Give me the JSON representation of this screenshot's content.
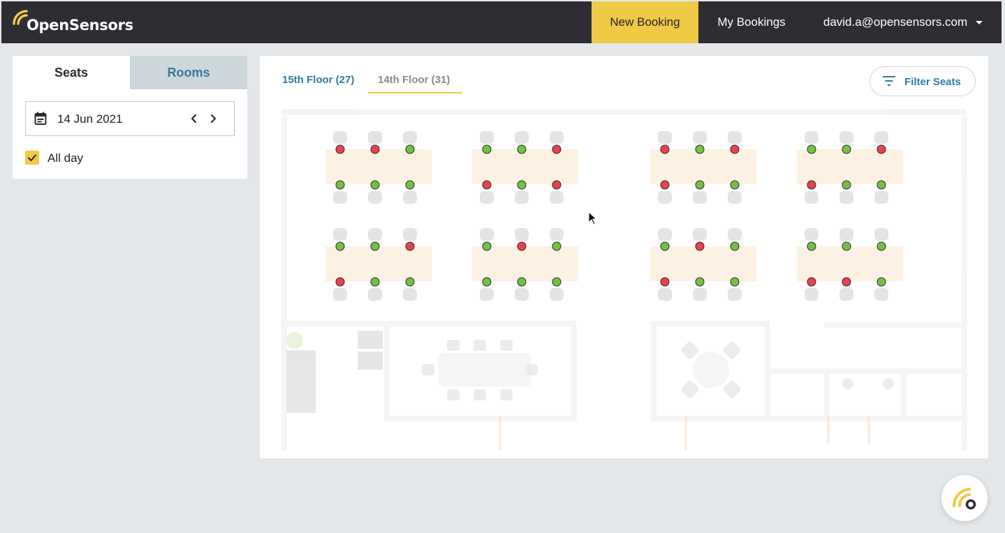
{
  "header": {
    "logo_text": "OpenSensors",
    "nav": {
      "new_booking": "New Booking",
      "my_bookings": "My Bookings",
      "user_email": "david.a@opensensors.com"
    }
  },
  "sidebar": {
    "tabs": {
      "seats": "Seats",
      "rooms": "Rooms"
    },
    "active_tab": "Seats",
    "date": "14 Jun 2021",
    "all_day": {
      "label": "All day",
      "checked": true
    }
  },
  "main": {
    "floor_tabs": [
      {
        "label": "15th Floor (27)",
        "active": false
      },
      {
        "label": "14th Floor (31)",
        "active": true
      }
    ],
    "filter_label": "Filter Seats",
    "legend_colors": {
      "available": "#74c043",
      "booked": "#e8414f"
    },
    "desk_blocks": [
      {
        "top": [
          "booked",
          "booked",
          "available"
        ],
        "bottom": [
          "available",
          "available",
          "available"
        ]
      },
      {
        "top": [
          "available",
          "available",
          "booked"
        ],
        "bottom": [
          "booked",
          "available",
          "booked"
        ]
      },
      {
        "top": [
          "booked",
          "available",
          "booked"
        ],
        "bottom": [
          "booked",
          "available",
          "available"
        ]
      },
      {
        "top": [
          "available",
          "available",
          "booked"
        ],
        "bottom": [
          "booked",
          "available",
          "available"
        ]
      },
      {
        "top": [
          "available",
          "available",
          "booked"
        ],
        "bottom": [
          "booked",
          "available",
          "available"
        ]
      },
      {
        "top": [
          "available",
          "booked",
          "available"
        ],
        "bottom": [
          "available",
          "available",
          "available"
        ]
      },
      {
        "top": [
          "available",
          "booked",
          "available"
        ],
        "bottom": [
          "booked",
          "available",
          "available"
        ]
      },
      {
        "top": [
          "available",
          "available",
          "available"
        ],
        "bottom": [
          "booked",
          "booked",
          "available"
        ]
      }
    ]
  },
  "colors": {
    "accent": "#efca45",
    "topbar": "#2f2c33",
    "link": "#2f7aa5"
  }
}
